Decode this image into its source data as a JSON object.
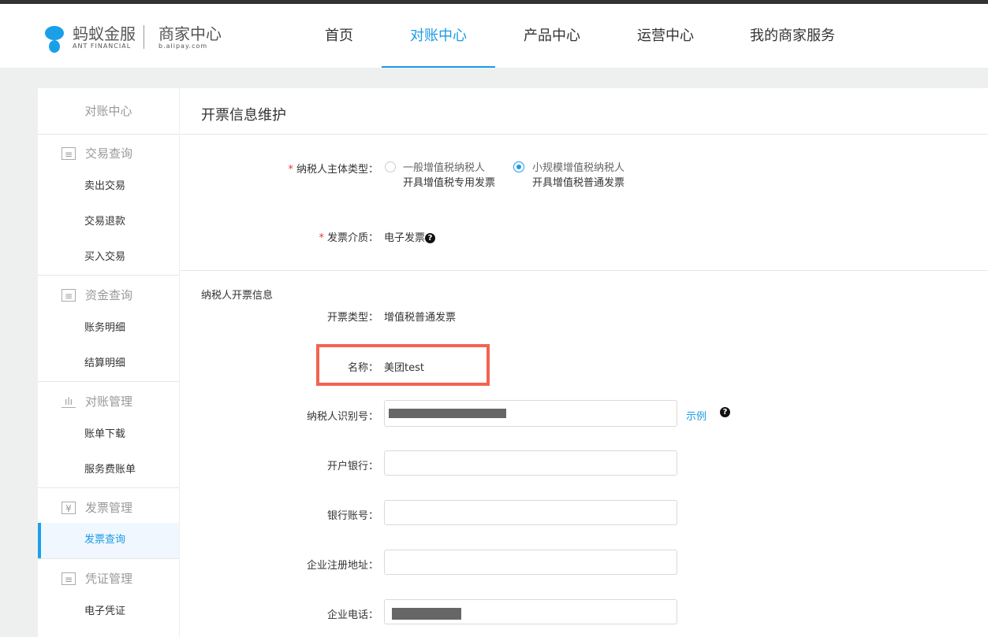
{
  "header": {
    "brand_cn": "蚂蚁金服",
    "brand_en": "ANT FINANCIAL",
    "site_cn": "商家中心",
    "site_url": "b.alipay.com",
    "nav": [
      "首页",
      "对账中心",
      "产品中心",
      "运营中心",
      "我的商家服务"
    ],
    "active_nav": "对账中心"
  },
  "sidebar": {
    "title": "对账中心",
    "groups": [
      {
        "label": "交易查询",
        "icon": "document-icon",
        "items": [
          "卖出交易",
          "交易退款",
          "买入交易"
        ]
      },
      {
        "label": "资金查询",
        "icon": "document-icon",
        "items": [
          "账务明细",
          "结算明细"
        ]
      },
      {
        "label": "对账管理",
        "icon": "bar-chart-icon",
        "items": [
          "账单下载",
          "服务费账单"
        ]
      },
      {
        "label": "发票管理",
        "icon": "yen-receipt-icon",
        "items": [
          "发票查询"
        ]
      },
      {
        "label": "凭证管理",
        "icon": "receipt-list-icon",
        "items": [
          "电子凭证"
        ]
      }
    ],
    "active_item": "发票查询"
  },
  "main": {
    "title": "开票信息维护",
    "taxpayer_type_label": "纳税人主体类型：",
    "options": [
      {
        "line1": "一般增值税纳税人",
        "line2": "开具增值税专用发票",
        "selected": false
      },
      {
        "line1": "小规模增值税纳税人",
        "line2": "开具增值税普通发票",
        "selected": true
      }
    ],
    "medium_label": "发票介质：",
    "medium_value": "电子发票",
    "section": "纳税人开票信息",
    "invoice_type_label": "开票类型：",
    "invoice_type_value": "增值税普通发票",
    "name_label": "名称：",
    "name_value": "美团test",
    "tax_id_label": "纳税人识别号：",
    "example_link": "示例",
    "bank_label": "开户银行：",
    "account_label": "银行账号：",
    "address_label": "企业注册地址：",
    "phone_label": "企业电话："
  },
  "colors": {
    "accent": "#1a9be6",
    "highlight": "#f46350"
  }
}
